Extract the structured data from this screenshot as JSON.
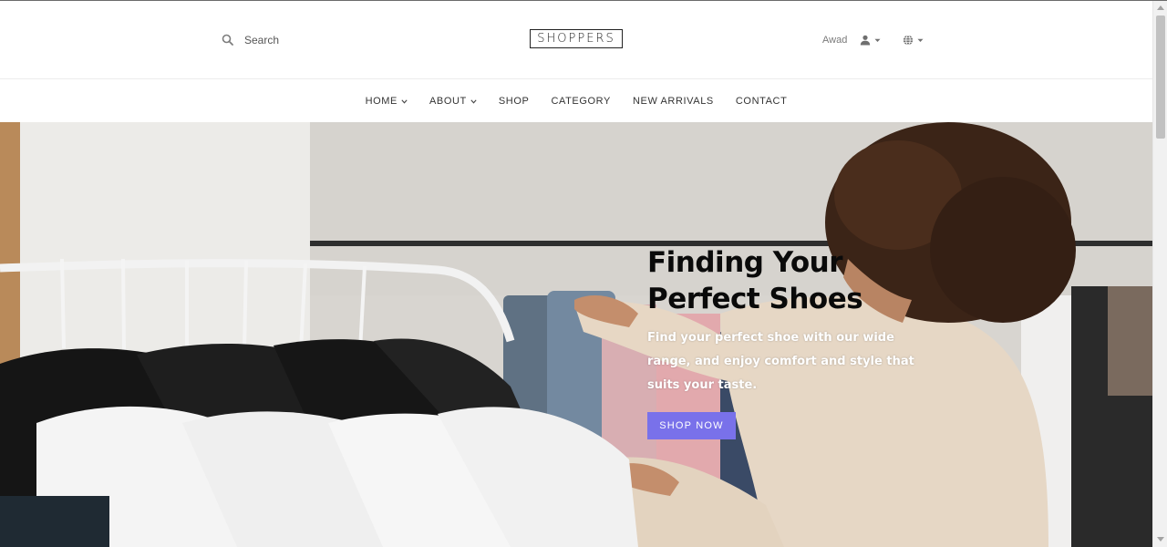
{
  "header": {
    "search_placeholder": "Search",
    "logo_text": "SHOPPERS",
    "username": "Awad"
  },
  "nav": {
    "items": [
      {
        "label": "HOME",
        "has_dropdown": true
      },
      {
        "label": "ABOUT",
        "has_dropdown": true
      },
      {
        "label": "SHOP",
        "has_dropdown": false
      },
      {
        "label": "CATEGORY",
        "has_dropdown": false
      },
      {
        "label": "NEW ARRIVALS",
        "has_dropdown": false
      },
      {
        "label": "CONTACT",
        "has_dropdown": false
      }
    ]
  },
  "hero": {
    "title_line1": "Finding Your",
    "title_line2": "Perfect Shoes",
    "description": "Find your perfect shoe with our wide range, and enjoy comfort and style that suits your taste.",
    "button_label": "SHOP NOW"
  },
  "colors": {
    "accent": "#7971ea",
    "text_dark": "#333333",
    "text_muted": "#7a7a7a"
  },
  "icons": {
    "search": "search-icon",
    "user": "user-icon",
    "globe": "globe-icon",
    "caret": "caret-down-icon"
  }
}
